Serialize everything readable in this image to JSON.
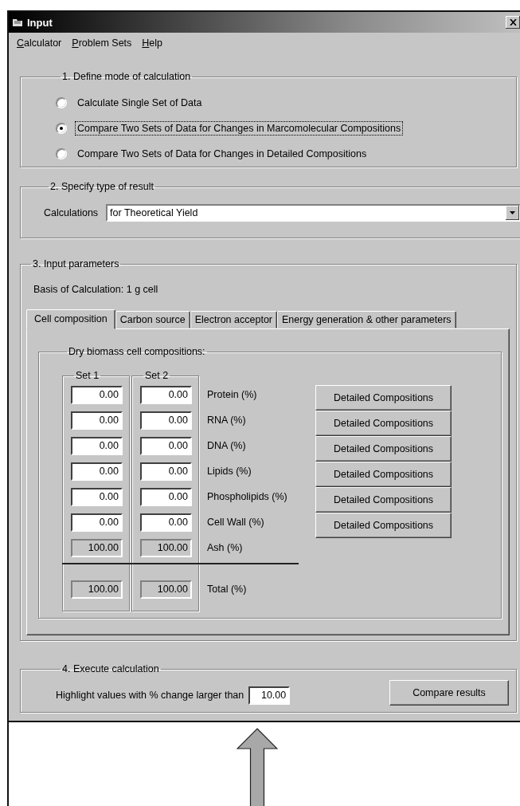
{
  "window": {
    "title": "Input"
  },
  "menu": [
    {
      "label": "Calculator"
    },
    {
      "label": "Problem Sets"
    },
    {
      "label": "Help"
    }
  ],
  "mode_group": {
    "title": "1. Define mode of calculation",
    "options": [
      {
        "label": "Calculate Single Set of Data",
        "selected": false
      },
      {
        "label": "Compare Two Sets of Data for Changes in Marcomolecular Compositions",
        "selected": true
      },
      {
        "label": "Compare Two Sets of Data for Changes in Detailed Compositions",
        "selected": false
      }
    ]
  },
  "result_group": {
    "title": "2. Specify type of result",
    "label": "Calculations",
    "value": "for Theoretical Yield"
  },
  "input_group": {
    "title": "3. Input parameters",
    "basis": "Basis of Calculation: 1 g cell",
    "tabs": [
      {
        "label": "Cell composition",
        "selected": true
      },
      {
        "label": "Carbon source",
        "selected": false
      },
      {
        "label": "Electron acceptor",
        "selected": false
      },
      {
        "label": "Energy generation & other parameters",
        "selected": false
      }
    ],
    "composition": {
      "title": "Dry biomass cell compositions:",
      "sets": [
        "Set 1",
        "Set 2"
      ],
      "rows": [
        {
          "label": "Protein (%)",
          "kind": "input",
          "values": [
            "0.00",
            "0.00"
          ],
          "button": "Detailed Compositions"
        },
        {
          "label": "RNA (%)",
          "kind": "input",
          "values": [
            "0.00",
            "0.00"
          ],
          "button": "Detailed Compositions"
        },
        {
          "label": "DNA (%)",
          "kind": "input",
          "values": [
            "0.00",
            "0.00"
          ],
          "button": "Detailed Compositions"
        },
        {
          "label": "Lipids (%)",
          "kind": "input",
          "values": [
            "0.00",
            "0.00"
          ],
          "button": "Detailed Compositions"
        },
        {
          "label": "Phospholipids (%)",
          "kind": "input",
          "values": [
            "0.00",
            "0.00"
          ],
          "button": "Detailed Compositions"
        },
        {
          "label": "Cell Wall (%)",
          "kind": "input",
          "values": [
            "0.00",
            "0.00"
          ],
          "button": "Detailed Compositions"
        },
        {
          "label": "Ash (%)",
          "kind": "computed",
          "values": [
            "100.00",
            "100.00"
          ]
        },
        {
          "label": "Total (%)",
          "kind": "total",
          "values": [
            "100.00",
            "100.00"
          ]
        }
      ]
    }
  },
  "execute_group": {
    "title": "4. Execute calculation",
    "label": "Highlight values with % change larger than",
    "value": "10.00",
    "button": "Compare results"
  }
}
